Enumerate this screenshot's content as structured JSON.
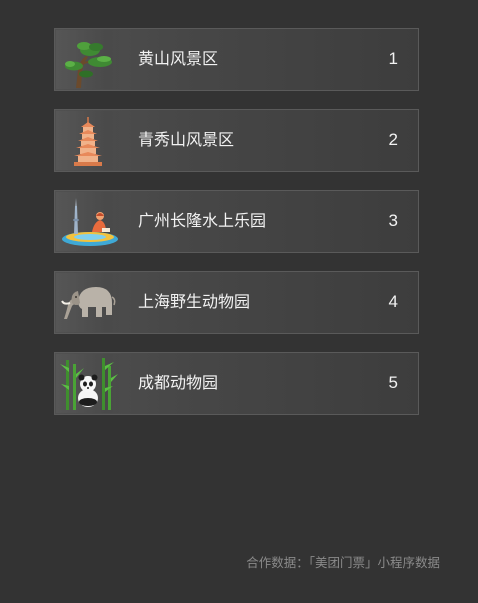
{
  "ranking": {
    "items": [
      {
        "rank": "1",
        "name": "黄山风景区",
        "icon": "pine-tree-icon"
      },
      {
        "rank": "2",
        "name": "青秀山风景区",
        "icon": "pagoda-icon"
      },
      {
        "rank": "3",
        "name": "广州长隆水上乐园",
        "icon": "water-park-icon"
      },
      {
        "rank": "4",
        "name": "上海野生动物园",
        "icon": "elephant-icon"
      },
      {
        "rank": "5",
        "name": "成都动物园",
        "icon": "panda-icon"
      }
    ]
  },
  "footer": {
    "source": "合作数据：「美团门票」小程序数据"
  }
}
